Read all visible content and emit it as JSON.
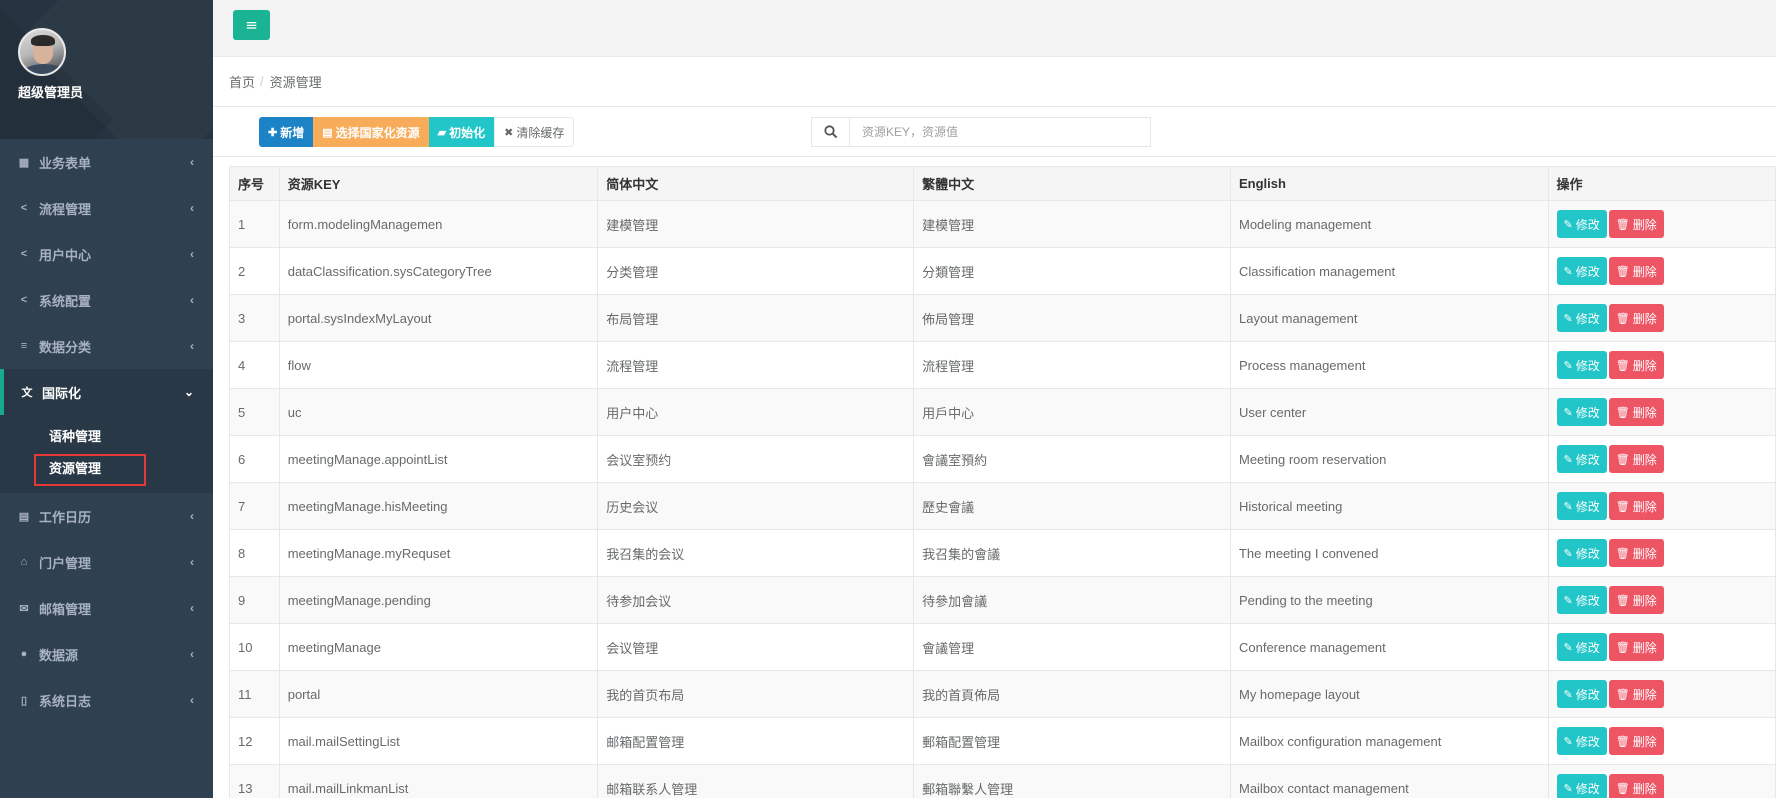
{
  "user": {
    "name": "超级管理员"
  },
  "sidebar": {
    "items": [
      {
        "label": "业务表单",
        "icon": "form-icon"
      },
      {
        "label": "流程管理",
        "icon": "share-icon"
      },
      {
        "label": "用户中心",
        "icon": "share-icon"
      },
      {
        "label": "系统配置",
        "icon": "share-icon"
      },
      {
        "label": "数据分类",
        "icon": "database-icon"
      },
      {
        "label": "国际化",
        "icon": "language-icon",
        "expanded": true
      },
      {
        "label": "工作日历",
        "icon": "calendar-icon"
      },
      {
        "label": "门户管理",
        "icon": "home-icon"
      },
      {
        "label": "邮箱管理",
        "icon": "envelope-icon"
      },
      {
        "label": "数据源",
        "icon": "dot-circle-icon"
      },
      {
        "label": "系统日志",
        "icon": "file-icon"
      }
    ],
    "subitems": [
      {
        "label": "语种管理"
      },
      {
        "label": "资源管理",
        "selected": true
      }
    ]
  },
  "breadcrumb": {
    "home": "首页",
    "sep": "/",
    "current": "资源管理"
  },
  "toolbar": {
    "add": "新增",
    "select_i18n": "选择国家化资源",
    "init": "初始化",
    "clear_cache": "清除缓存"
  },
  "search": {
    "placeholder": "资源KEY，资源值"
  },
  "table": {
    "headers": [
      "序号",
      "资源KEY",
      "简体中文",
      "繁體中文",
      "English",
      "操作"
    ],
    "edit_label": "修改",
    "delete_label": "删除",
    "rows": [
      [
        "1",
        "form.modelingManagemen",
        "建模管理",
        "建模管理",
        "Modeling management"
      ],
      [
        "2",
        "dataClassification.sysCategoryTree",
        "分类管理",
        "分類管理",
        "Classification management"
      ],
      [
        "3",
        "portal.sysIndexMyLayout",
        "布局管理",
        "佈局管理",
        "Layout management"
      ],
      [
        "4",
        "flow",
        "流程管理",
        "流程管理",
        "Process management"
      ],
      [
        "5",
        "uc",
        "用户中心",
        "用戶中心",
        "User center"
      ],
      [
        "6",
        "meetingManage.appointList",
        "会议室预约",
        "會議室預約",
        "Meeting room reservation"
      ],
      [
        "7",
        "meetingManage.hisMeeting",
        "历史会议",
        "歷史會議",
        "Historical meeting"
      ],
      [
        "8",
        "meetingManage.myRequset",
        "我召集的会议",
        "我召集的會議",
        "The meeting I convened"
      ],
      [
        "9",
        "meetingManage.pending",
        "待参加会议",
        "待參加會議",
        "Pending to the meeting"
      ],
      [
        "10",
        "meetingManage",
        "会议管理",
        "會議管理",
        "Conference management"
      ],
      [
        "11",
        "portal",
        "我的首页布局",
        "我的首頁佈局",
        "My homepage layout"
      ],
      [
        "12",
        "mail.mailSettingList",
        "邮箱配置管理",
        "郵箱配置管理",
        "Mailbox configuration management"
      ],
      [
        "13",
        "mail.mailLinkmanList",
        "邮箱联系人管理",
        "郵箱聯繫人管理",
        "Mailbox contact management"
      ]
    ]
  },
  "colors": {
    "sidebar": "#2f4050",
    "primary": "#1ab394",
    "blue": "#1c84c6",
    "orange": "#f8ac59",
    "teal": "#23c6c8",
    "red": "#ed5565"
  }
}
